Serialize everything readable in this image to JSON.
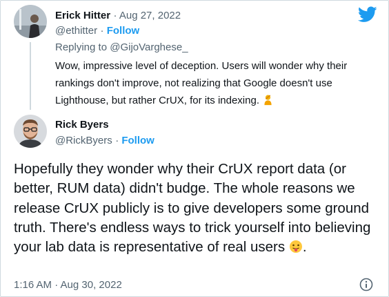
{
  "reply_tweet": {
    "author_name": "Erick Hitter",
    "date": "Aug 27, 2022",
    "handle": "@ethitter",
    "follow_label": "Follow",
    "replying_to": "Replying to @GijoVarghese_",
    "text": "Wow, impressive level of deception. Users will wonder why their rankings don't improve, not realizing that Google doesn't use Lighthouse, but rather CrUX, for its indexing.",
    "emoji": "person-facepalming-emoji"
  },
  "main_tweet": {
    "author_name": "Rick Byers",
    "handle": "@RickByers",
    "follow_label": "Follow",
    "text": "Hopefully they wonder why their CrUX report data (or better, RUM data) didn't budge. The whole reasons we release CrUX publicly is to give developers some ground truth. There's endless ways to trick yourself into believing your lab data is representative of real users",
    "text_end": ".",
    "emoji": "tongue-out-emoji",
    "timestamp": "1:16 AM · Aug 30, 2022"
  },
  "colors": {
    "brand": "#1d9bf0",
    "text": "#0f1419",
    "muted": "#536471",
    "border": "#cfd9de"
  },
  "icons": [
    "twitter-logo-icon",
    "info-icon"
  ]
}
